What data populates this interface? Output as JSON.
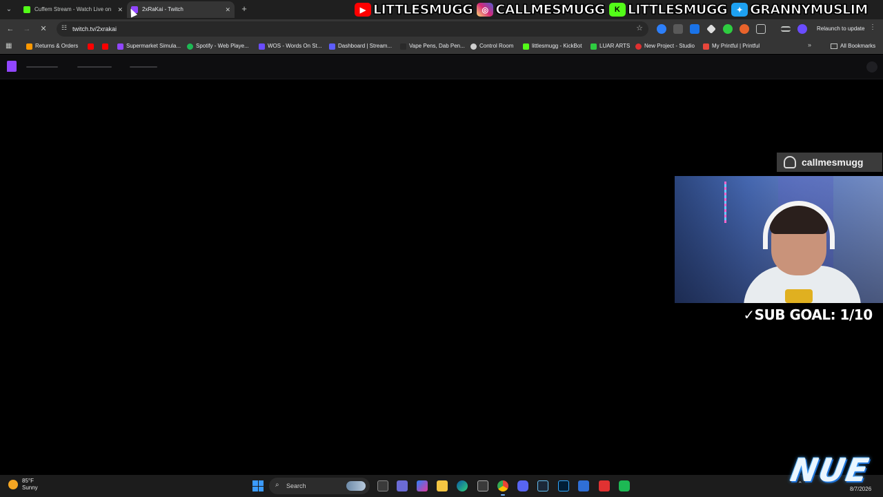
{
  "browser": {
    "tabs": [
      {
        "title": "Cuffem Stream - Watch Live on",
        "favicon_color": "#53fc18",
        "active": false
      },
      {
        "title": "2xRaKai - Twitch",
        "favicon_color": "#9146ff",
        "active": true
      }
    ],
    "new_tab_icon": "plus-icon",
    "address": "twitch.tv/2xrakai",
    "relaunch_label": "Relaunch to update",
    "bookmarks": [
      {
        "label": "Returns & Orders",
        "color": "#ff9900"
      },
      {
        "label": "",
        "color": "#ff0000"
      },
      {
        "label": "",
        "color": "#ff0000"
      },
      {
        "label": "Supermarket Simula...",
        "color": "#9146ff"
      },
      {
        "label": "Spotify - Web Playe...",
        "color": "#1db954"
      },
      {
        "label": "WOS - Words On St...",
        "color": "#6a4cff"
      },
      {
        "label": "Dashboard | Stream...",
        "color": "#5d5dff"
      },
      {
        "label": "Vape Pens, Dab Pen...",
        "color": "#2a2a2a"
      },
      {
        "label": "Control Room",
        "color": "#cfcfcf"
      },
      {
        "label": "littlesmugg - KickBot",
        "color": "#53fc18"
      },
      {
        "label": "LUAR ARTS",
        "color": "#2ecc40"
      },
      {
        "label": "New Project - Studio",
        "color": "#e03030"
      },
      {
        "label": "My Printful | Printful",
        "color": "#e8463b"
      }
    ],
    "all_bookmarks_label": "All Bookmarks"
  },
  "overlay": {
    "socials": [
      {
        "platform": "youtube",
        "icon": "youtube-icon",
        "color": "#ff0000",
        "handle": "LITTLESMUGG"
      },
      {
        "platform": "instagram",
        "icon": "instagram-icon",
        "color": "#d62976",
        "handle": "CALLMESMUGG"
      },
      {
        "platform": "kick",
        "icon": "kick-icon",
        "color": "#53fc18",
        "handle": "LITTLESMUGG"
      },
      {
        "platform": "twitter",
        "icon": "twitter-icon",
        "color": "#1da1f2",
        "handle": "GRANNYMUSLIM"
      }
    ],
    "snapchat_handle": "callmesmugg",
    "sub_goal": "SUB GOAL: 1/10",
    "sub_goal_check": "✓",
    "logo_text": "NUE"
  },
  "taskbar": {
    "temperature": "85°F",
    "condition": "Sunny",
    "search_label": "Search",
    "date": "8/7/2026"
  }
}
